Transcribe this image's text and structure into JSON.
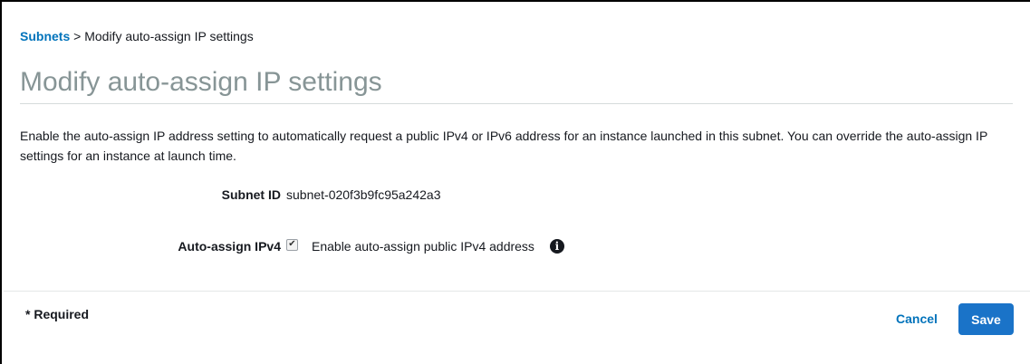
{
  "breadcrumb": {
    "root": "Subnets",
    "separator": ">",
    "current": "Modify auto-assign IP settings"
  },
  "page": {
    "title": "Modify auto-assign IP settings",
    "description": "Enable the auto-assign IP address setting to automatically request a public IPv4 or IPv6 address for an instance launched in this subnet. You can override the auto-assign IP settings for an instance at launch time."
  },
  "form": {
    "subnet_id_label": "Subnet ID",
    "subnet_id_value": "subnet-020f3b9fc95a242a3",
    "auto_assign_label": "Auto-assign IPv4",
    "auto_assign_checked": true,
    "auto_assign_text": "Enable auto-assign public IPv4 address",
    "info_icon": "info-icon",
    "checkmark_glyph": "✔",
    "info_glyph": "i"
  },
  "footer": {
    "required": "* Required",
    "cancel_label": "Cancel",
    "save_label": "Save"
  },
  "colors": {
    "link": "#0073bb",
    "primary_button": "#1a73c8",
    "title": "#879596"
  }
}
